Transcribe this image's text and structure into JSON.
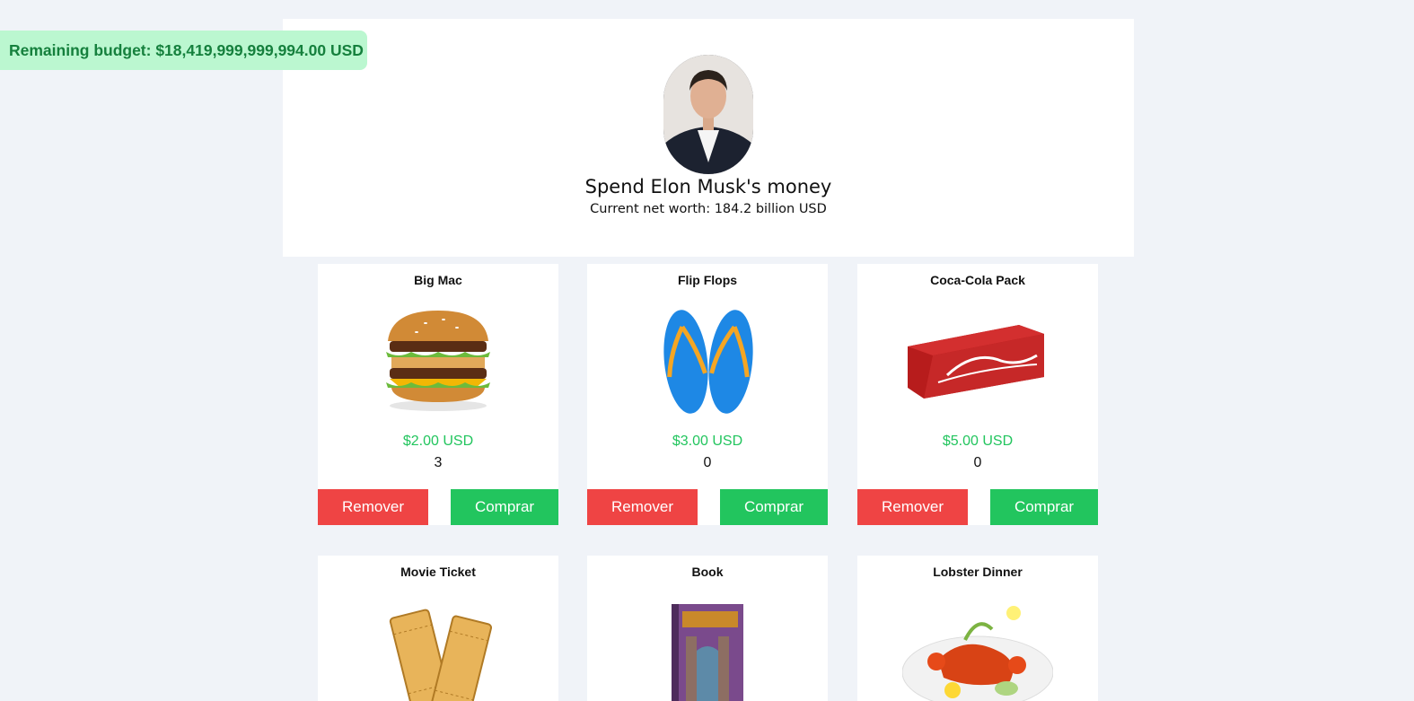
{
  "budget": {
    "text": "Remaining budget: $18,419,999,999,994.00 USD"
  },
  "header": {
    "title": "Spend Elon Musk's money",
    "net_worth": "Current net worth: 184.2 billion USD"
  },
  "products": [
    {
      "name": "Big Mac",
      "price": "$2.00 USD",
      "quantity": "3",
      "remove_label": "Remover",
      "buy_label": "Comprar",
      "icon": "burger-icon"
    },
    {
      "name": "Flip Flops",
      "price": "$3.00 USD",
      "quantity": "0",
      "remove_label": "Remover",
      "buy_label": "Comprar",
      "icon": "flip-flops-icon"
    },
    {
      "name": "Coca-Cola Pack",
      "price": "$5.00 USD",
      "quantity": "0",
      "remove_label": "Remover",
      "buy_label": "Comprar",
      "icon": "soda-pack-icon"
    },
    {
      "name": "Movie Ticket",
      "icon": "ticket-icon"
    },
    {
      "name": "Book",
      "icon": "book-icon"
    },
    {
      "name": "Lobster Dinner",
      "icon": "lobster-icon"
    }
  ],
  "colors": {
    "background": "#f0f3f8",
    "budget_bg": "#bbf7d0",
    "budget_text": "#15803d",
    "price": "#22c55e",
    "remove": "#ef4444",
    "buy": "#22c55e"
  }
}
